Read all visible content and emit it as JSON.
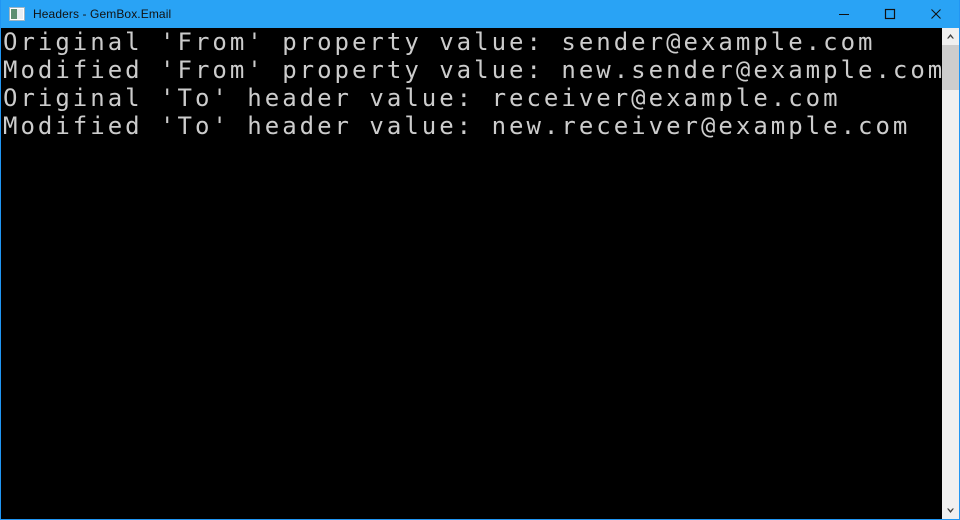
{
  "window": {
    "title": "Headers - GemBox.Email",
    "icon": "console-window-icon",
    "accent_color": "#29a3f5",
    "console_background": "#000000",
    "console_text_color": "#cccccc",
    "controls": {
      "minimize_label": "Minimize",
      "maximize_label": "Maximize",
      "close_label": "Close"
    }
  },
  "console": {
    "lines": [
      "Original 'From' property value: sender@example.com",
      "Modified 'From' property value: new.sender@example.com",
      "Original 'To' header value: receiver@example.com",
      "Modified 'To' header value: new.receiver@example.com"
    ]
  },
  "scrollbar": {
    "up_arrow": "chevron-up-icon",
    "down_arrow": "chevron-down-icon",
    "thumb_position": "top"
  }
}
